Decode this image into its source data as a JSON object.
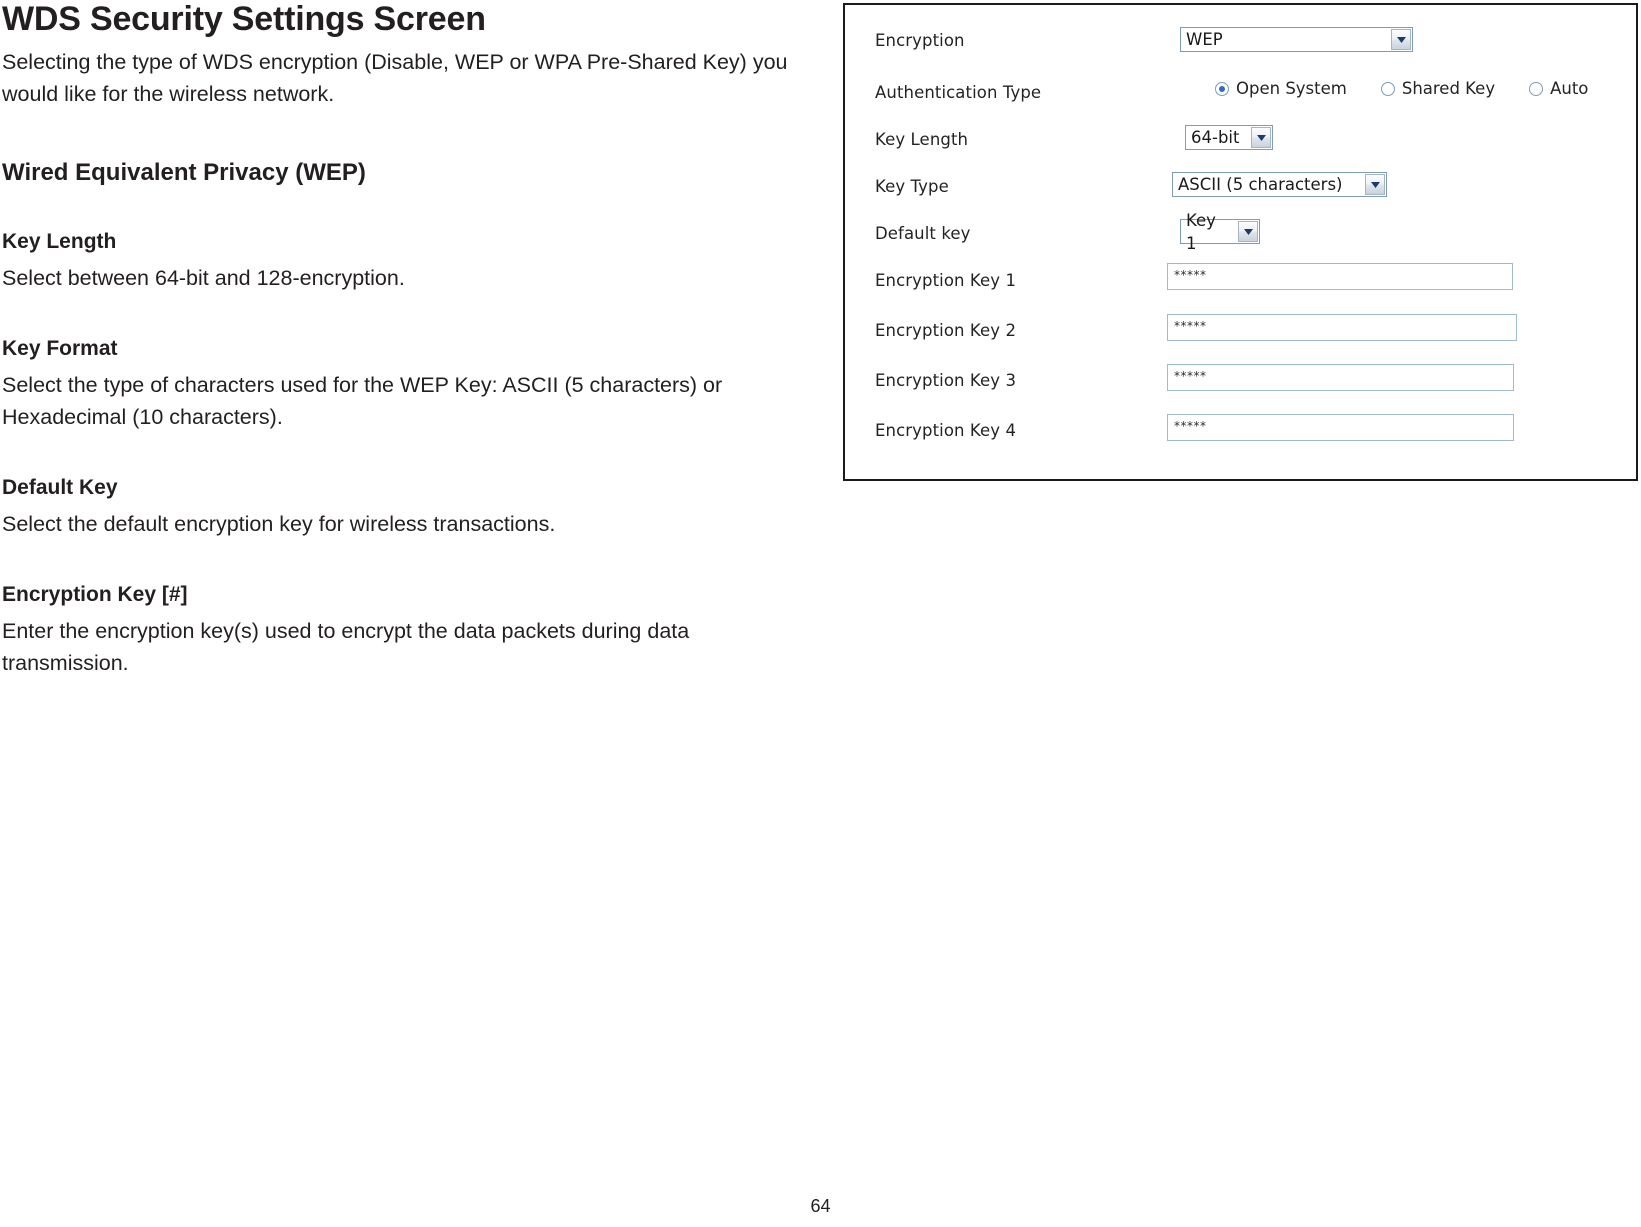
{
  "document": {
    "title": "WDS Security Settings Screen",
    "intro": "Selecting the type of WDS encryption (Disable, WEP or WPA Pre-Shared Key) you would like for the wireless network.",
    "section_heading": "Wired Equivalent Privacy (WEP)",
    "sections": [
      {
        "heading": "Key Length",
        "body": "Select between 64-bit and 128-encryption."
      },
      {
        "heading": "Key Format",
        "body": "Select the type of characters used for the WEP Key: ASCII (5 characters) or Hexadecimal (10 characters)."
      },
      {
        "heading": "Default Key",
        "body": "Select the default encryption key for wireless transactions."
      },
      {
        "heading": "Encryption Key [#]",
        "body": "Enter the encryption key(s) used to encrypt the data packets during data transmission."
      }
    ],
    "page_number": "64"
  },
  "screenshot": {
    "fields": {
      "encryption": {
        "label": "Encryption",
        "value": "WEP"
      },
      "authentication_type": {
        "label": "Authentication Type",
        "options": [
          {
            "label": "Open System",
            "selected": true
          },
          {
            "label": "Shared Key",
            "selected": false
          },
          {
            "label": "Auto",
            "selected": false
          }
        ]
      },
      "key_length": {
        "label": "Key Length",
        "value": "64-bit"
      },
      "key_type": {
        "label": "Key Type",
        "value": "ASCII (5 characters)"
      },
      "default_key": {
        "label": "Default key",
        "value": "Key 1"
      },
      "encryption_keys": [
        {
          "label": "Encryption Key 1",
          "value": "*****"
        },
        {
          "label": "Encryption Key 2",
          "value": "*****"
        },
        {
          "label": "Encryption Key 3",
          "value": "*****"
        },
        {
          "label": "Encryption Key 4",
          "value": "*****"
        }
      ]
    }
  }
}
